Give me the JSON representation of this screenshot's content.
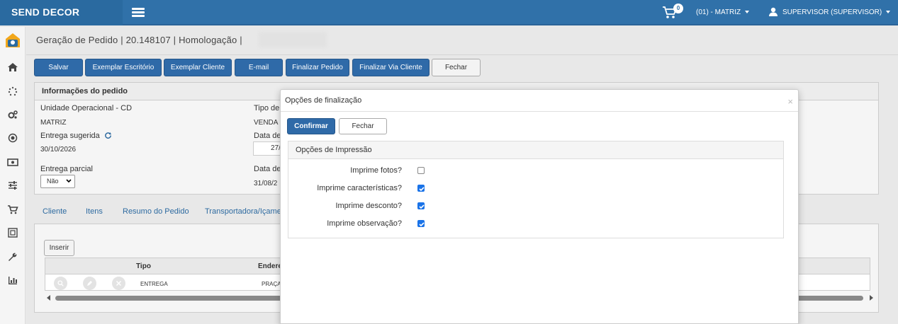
{
  "topbar": {
    "brand": "SEND DECOR",
    "cart_count": "0",
    "unit": "(01) - MATRIZ",
    "user": "SUPERVISOR (SUPERVISOR)"
  },
  "sidebar": {
    "icons": [
      "home-icon",
      "spinner-icon",
      "cogs-icon",
      "target-icon",
      "money-icon",
      "sliders-icon",
      "cart-icon",
      "image-icon",
      "wrench-icon",
      "chart-icon"
    ]
  },
  "page": {
    "title": "Geração de Pedido | 20.148107 | Homologação |"
  },
  "toolbar": {
    "save": "Salvar",
    "office_copy": "Exemplar Escritório",
    "client_copy": "Exemplar Cliente",
    "email": "E-mail",
    "finalize": "Finalizar Pedido",
    "finalize_client": "Finalizar Via Cliente",
    "close": "Fechar"
  },
  "order_info": {
    "header": "Informações do pedido",
    "unit_label": "Unidade Operacional - CD",
    "unit_value": "MATRIZ",
    "type_label": "Tipo de",
    "type_value": "VENDA I",
    "delivery_label": "Entrega sugerida",
    "delivery_value": "30/10/2026",
    "date_label": "Data de",
    "date_value": "27/",
    "partial_label": "Entrega parcial",
    "partial_value": "Não",
    "date2_label": "Data de",
    "date2_value": "31/08/2"
  },
  "tabs": [
    "Cliente",
    "Itens",
    "Resumo do Pedido",
    "Transportadora/Içame"
  ],
  "address_tab": {
    "insert": "Inserir",
    "col_type": "Tipo",
    "col_address": "Endere",
    "row_type": "ENTREGA",
    "row_address": "PRAÇA"
  },
  "modal": {
    "title": "Opções de finalização",
    "close_x": "×",
    "confirm": "Confirmar",
    "close": "Fechar",
    "print_header": "Opções de Impressão",
    "options": [
      {
        "label": "Imprime fotos?",
        "checked": false
      },
      {
        "label": "Imprime características?",
        "checked": true
      },
      {
        "label": "Imprime desconto?",
        "checked": true
      },
      {
        "label": "Imprime observação?",
        "checked": true
      }
    ]
  }
}
